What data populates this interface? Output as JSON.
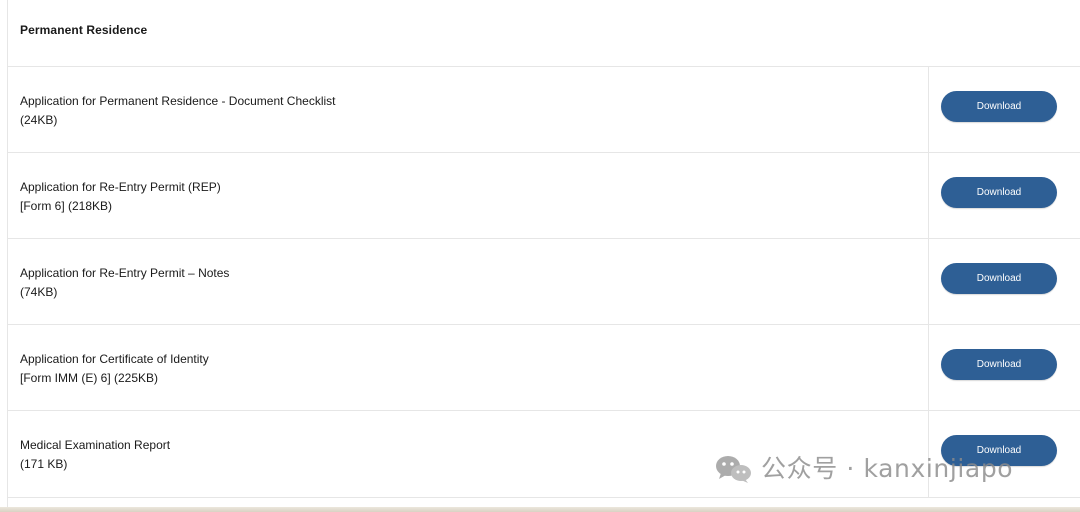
{
  "section": {
    "title": "Permanent Residence"
  },
  "documents": [
    {
      "title": "Application for Permanent Residence - Document Checklist",
      "meta": "(24KB)",
      "action_label": "Download"
    },
    {
      "title": "Application for Re-Entry Permit (REP)",
      "meta": "[Form 6] (218KB)",
      "action_label": "Download"
    },
    {
      "title": "Application for Re-Entry Permit – Notes",
      "meta": "(74KB)",
      "action_label": "Download"
    },
    {
      "title": "Application for Certificate of Identity",
      "meta": "[Form IMM (E) 6] (225KB)",
      "action_label": "Download"
    },
    {
      "title": "Medical Examination Report",
      "meta": "(171 KB)",
      "action_label": "Download"
    }
  ],
  "watermark": {
    "text": "公众号 · kanxinjiapo",
    "icon": "wechat-icon"
  },
  "colors": {
    "button": "#2e5f95",
    "button_text": "#ffffff",
    "divider": "#e6e6e6",
    "watermark": "#8c8c8c"
  }
}
